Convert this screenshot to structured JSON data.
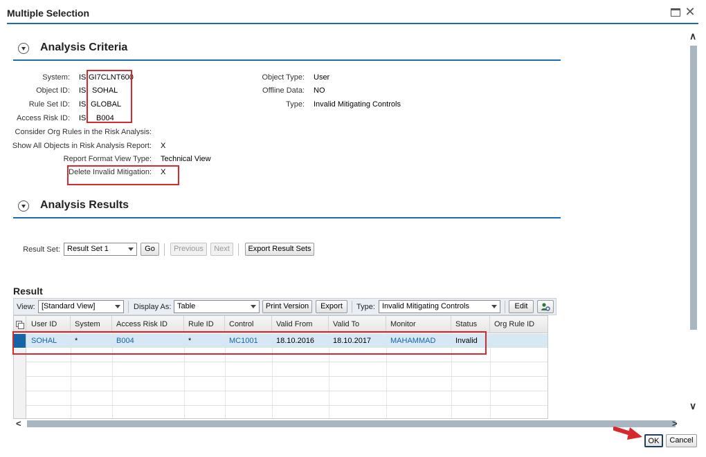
{
  "window": {
    "title": "Multiple Selection"
  },
  "criteria": {
    "section_title": "Analysis Criteria",
    "system": {
      "label": "System:",
      "op": "IS",
      "value": "GI7CLNT600"
    },
    "object_id": {
      "label": "Object ID:",
      "op": "IS",
      "value": "SOHAL"
    },
    "rule_set_id": {
      "label": "Rule Set ID:",
      "op": "IS",
      "value": "GLOBAL"
    },
    "access_risk_id": {
      "label": "Access Risk ID:",
      "op": "IS",
      "value": "B004"
    },
    "org_rules": {
      "label": "Consider Org Rules in the Risk Analysis:",
      "value": ""
    },
    "show_all": {
      "label": "Show All Objects in Risk Analysis Report:",
      "value": "X"
    },
    "report_format": {
      "label": "Report Format View Type:",
      "value": "Technical View"
    },
    "delete_invalid": {
      "label": "Delete Invalid Mitigation:",
      "value": "X"
    },
    "object_type": {
      "label": "Object Type:",
      "value": "User"
    },
    "offline_data": {
      "label": "Offline Data:",
      "value": "NO"
    },
    "type": {
      "label": "Type:",
      "value": "Invalid Mitigating Controls"
    }
  },
  "results": {
    "section_title": "Analysis Results",
    "result_set_label": "Result Set:",
    "result_set_value": "Result Set 1",
    "go": "Go",
    "previous": "Previous",
    "next": "Next",
    "export_sets": "Export Result Sets"
  },
  "result": {
    "title": "Result",
    "view_label": "View:",
    "view_value": "[Standard View]",
    "display_label": "Display As:",
    "display_value": "Table",
    "print_version": "Print Version",
    "export": "Export",
    "type_label": "Type:",
    "type_value": "Invalid Mitigating Controls",
    "edit": "Edit",
    "columns": [
      "User ID",
      "System",
      "Access Risk ID",
      "Rule ID",
      "Control",
      "Valid From",
      "Valid To",
      "Monitor",
      "Status",
      "Org Rule ID"
    ],
    "rows": [
      [
        "SOHAL",
        "*",
        "B004",
        "*",
        "MC1001",
        "18.10.2016",
        "18.10.2017",
        "MAHAMMAD",
        "Invalid",
        ""
      ]
    ]
  },
  "footer": {
    "ok": "OK",
    "cancel": "Cancel"
  },
  "colors": {
    "accent": "#1a6bb0",
    "highlight": "#d9272e",
    "link": "#1664a8",
    "selected_row": "#d6e8f4"
  },
  "icons": [
    "maximize-icon",
    "close-icon",
    "collapse-icon",
    "settings-person-icon",
    "pointer-arrow-icon"
  ]
}
